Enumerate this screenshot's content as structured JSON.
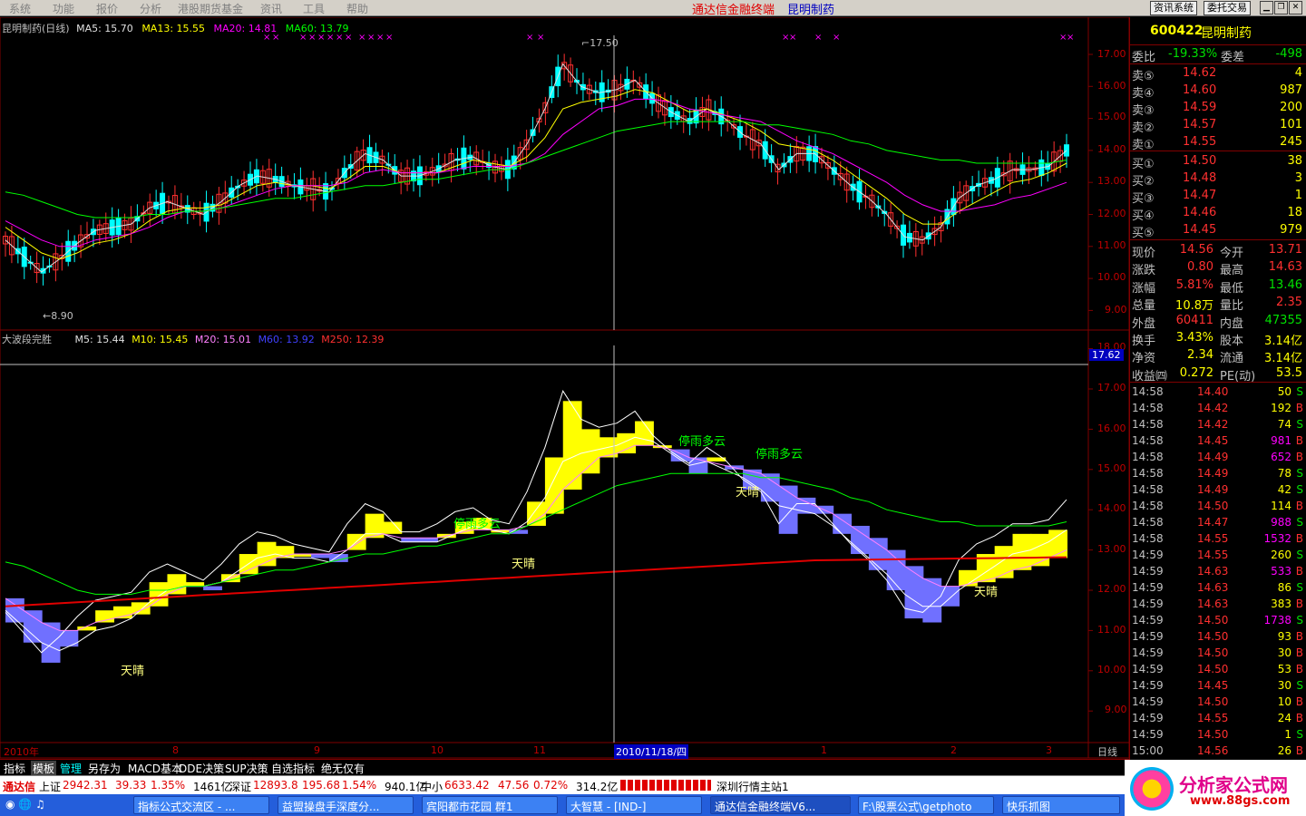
{
  "menubar": {
    "items": [
      "系统",
      "功能",
      "报价",
      "分析",
      "港股期货基金",
      "资讯",
      "工具",
      "帮助"
    ],
    "app_title": "通达信金融终端",
    "stock_title": "昆明制药",
    "btn_info": "资讯系统",
    "btn_trade": "委托交易"
  },
  "top_chart": {
    "header": {
      "name": "昆明制药(日线)",
      "ma5": "MA5: 15.70",
      "ma13": "MA13: 15.55",
      "ma20": "MA20: 14.81",
      "ma60": "MA60: 13.79"
    },
    "y_ticks": [
      "17.00",
      "16.00",
      "15.00",
      "14.00",
      "13.00",
      "12.00",
      "11.00",
      "10.00",
      "9.00"
    ],
    "high_label": "17.50",
    "low_label": "8.90",
    "marker": "×"
  },
  "bottom_chart": {
    "header": {
      "name": "大波段完胜",
      "m5": "M5: 15.44",
      "m10": "M10: 15.45",
      "m20": "M20: 15.01",
      "m60": "M60: 13.92",
      "m250": "M250: 12.39"
    },
    "y_ticks": [
      "18.00",
      "17.00",
      "16.00",
      "15.00",
      "14.00",
      "13.00",
      "12.00",
      "11.00",
      "10.00",
      "9.00"
    ],
    "cursor_value": "17.62",
    "annotations": [
      {
        "text": "停雨多云",
        "color": "#00ff00"
      },
      {
        "text": "停雨多云",
        "color": "#00ff00"
      },
      {
        "text": "停雨多云",
        "color": "#00ff00"
      },
      {
        "text": "天晴",
        "color": "#ffff80"
      },
      {
        "text": "天晴",
        "color": "#ffff80"
      },
      {
        "text": "天晴",
        "color": "#ffff80"
      },
      {
        "text": "天晴",
        "color": "#ffff80"
      }
    ]
  },
  "x_axis": {
    "labels": [
      "2010年",
      "8",
      "9",
      "10",
      "11",
      "2010/11/18/四",
      "1",
      "2",
      "3"
    ],
    "period": "日线"
  },
  "chart_data": {
    "type": "line",
    "title": "",
    "ylim": [
      8.5,
      17.6
    ],
    "series": [
      {
        "name": "MA5",
        "values": [
          11.2,
          10.7,
          10.2,
          10.6,
          11.1,
          11.5,
          11.6,
          11.7,
          12.2,
          12.4,
          12.2,
          12.0,
          12.4,
          12.9,
          13.2,
          13.1,
          12.9,
          12.8,
          12.7,
          13.4,
          13.9,
          13.7,
          13.2,
          13.2,
          13.4,
          13.7,
          13.8,
          13.5,
          13.4,
          14.2,
          15.3,
          16.7,
          16.0,
          15.8,
          15.9,
          16.2,
          15.6,
          15.2,
          14.9,
          15.3,
          15.0,
          14.5,
          14.2,
          13.4,
          13.9,
          13.9,
          13.4,
          12.9,
          12.5,
          12.0,
          11.3,
          11.2,
          11.6,
          12.5,
          12.9,
          13.1,
          13.4,
          13.4,
          13.5,
          14.0
        ]
      },
      {
        "name": "MA13",
        "values": [
          11.6,
          11.2,
          10.8,
          10.6,
          10.8,
          11.1,
          11.2,
          11.4,
          11.8,
          12.1,
          12.2,
          12.2,
          12.3,
          12.6,
          12.9,
          13.0,
          12.9,
          12.9,
          12.8,
          13.1,
          13.5,
          13.5,
          13.3,
          13.3,
          13.3,
          13.5,
          13.7,
          13.6,
          13.5,
          13.8,
          14.4,
          15.3,
          15.5,
          15.6,
          15.7,
          15.9,
          15.8,
          15.5,
          15.2,
          15.3,
          15.1,
          14.9,
          14.6,
          14.2,
          14.1,
          14.0,
          13.7,
          13.3,
          12.9,
          12.5,
          12.0,
          11.7,
          11.7,
          12.1,
          12.4,
          12.7,
          13.0,
          13.1,
          13.3,
          13.6
        ]
      },
      {
        "name": "MA20",
        "values": [
          11.8,
          11.5,
          11.2,
          11.0,
          11.0,
          11.2,
          11.3,
          11.4,
          11.6,
          11.9,
          12.1,
          12.1,
          12.2,
          12.4,
          12.6,
          12.8,
          12.9,
          12.9,
          12.9,
          13.0,
          13.3,
          13.4,
          13.3,
          13.3,
          13.3,
          13.4,
          13.5,
          13.5,
          13.5,
          13.6,
          13.9,
          14.5,
          14.9,
          15.3,
          15.4,
          15.6,
          15.6,
          15.5,
          15.3,
          15.2,
          15.1,
          15.0,
          14.9,
          14.6,
          14.3,
          14.1,
          13.9,
          13.6,
          13.3,
          13.0,
          12.6,
          12.3,
          12.1,
          12.1,
          12.2,
          12.3,
          12.5,
          12.6,
          12.8,
          13.0
        ]
      },
      {
        "name": "MA60",
        "values": [
          12.7,
          12.6,
          12.4,
          12.2,
          12.0,
          11.9,
          11.9,
          11.9,
          12.0,
          12.0,
          12.1,
          12.1,
          12.2,
          12.3,
          12.4,
          12.5,
          12.5,
          12.6,
          12.7,
          12.8,
          12.9,
          12.9,
          13.0,
          13.1,
          13.1,
          13.2,
          13.3,
          13.4,
          13.4,
          13.6,
          13.8,
          14.0,
          14.2,
          14.4,
          14.6,
          14.7,
          14.8,
          14.9,
          14.9,
          14.9,
          14.9,
          14.9,
          14.8,
          14.8,
          14.7,
          14.6,
          14.5,
          14.3,
          14.2,
          14.0,
          13.9,
          13.8,
          13.7,
          13.7,
          13.6,
          13.6,
          13.6,
          13.6,
          13.6,
          13.7
        ]
      }
    ]
  },
  "right_panel": {
    "code": "600422",
    "name": "昆明制药",
    "weibi_label": "委比",
    "weibi": "-19.33%",
    "weicha_label": "委差",
    "weicha": "-498",
    "asks": [
      {
        "label": "卖⑤",
        "price": "14.62",
        "vol": "4"
      },
      {
        "label": "卖④",
        "price": "14.60",
        "vol": "987"
      },
      {
        "label": "卖③",
        "price": "14.59",
        "vol": "200"
      },
      {
        "label": "卖②",
        "price": "14.57",
        "vol": "101"
      },
      {
        "label": "卖①",
        "price": "14.55",
        "vol": "245"
      }
    ],
    "bids": [
      {
        "label": "买①",
        "price": "14.50",
        "vol": "38"
      },
      {
        "label": "买②",
        "price": "14.48",
        "vol": "3"
      },
      {
        "label": "买③",
        "price": "14.47",
        "vol": "1"
      },
      {
        "label": "买④",
        "price": "14.46",
        "vol": "18"
      },
      {
        "label": "买⑤",
        "price": "14.45",
        "vol": "979"
      }
    ],
    "stats": [
      {
        "l1": "现价",
        "v1": "14.56",
        "c1": "#ff3030",
        "l2": "今开",
        "v2": "13.71",
        "c2": "#ff3030"
      },
      {
        "l1": "涨跌",
        "v1": "0.80",
        "c1": "#ff3030",
        "l2": "最高",
        "v2": "14.63",
        "c2": "#ff3030"
      },
      {
        "l1": "涨幅",
        "v1": "5.81%",
        "c1": "#ff3030",
        "l2": "最低",
        "v2": "13.46",
        "c2": "#00e000"
      },
      {
        "l1": "总量",
        "v1": "10.8万",
        "c1": "#ffff00",
        "l2": "量比",
        "v2": "2.35",
        "c2": "#ff3030"
      },
      {
        "l1": "外盘",
        "v1": "60411",
        "c1": "#ff3030",
        "l2": "内盘",
        "v2": "47355",
        "c2": "#00e000"
      },
      {
        "l1": "换手",
        "v1": "3.43%",
        "c1": "#ffff00",
        "l2": "股本",
        "v2": "3.14亿",
        "c2": "#ffff00"
      },
      {
        "l1": "净资",
        "v1": "2.34",
        "c1": "#ffff00",
        "l2": "流通",
        "v2": "3.14亿",
        "c2": "#ffff00"
      },
      {
        "l1": "收益㈣",
        "v1": "0.272",
        "c1": "#ffff00",
        "l2": "PE(动)",
        "v2": "53.5",
        "c2": "#ffff00"
      }
    ],
    "ticks": [
      {
        "t": "14:58",
        "p": "14.40",
        "v": "50",
        "s": "S"
      },
      {
        "t": "14:58",
        "p": "14.42",
        "v": "192",
        "s": "B"
      },
      {
        "t": "14:58",
        "p": "14.42",
        "v": "74",
        "s": "S"
      },
      {
        "t": "14:58",
        "p": "14.45",
        "v": "981",
        "s": "B"
      },
      {
        "t": "14:58",
        "p": "14.49",
        "v": "652",
        "s": "B"
      },
      {
        "t": "14:58",
        "p": "14.49",
        "v": "78",
        "s": "S"
      },
      {
        "t": "14:58",
        "p": "14.49",
        "v": "42",
        "s": "S"
      },
      {
        "t": "14:58",
        "p": "14.50",
        "v": "114",
        "s": "B"
      },
      {
        "t": "14:58",
        "p": "14.47",
        "v": "988",
        "s": "S"
      },
      {
        "t": "14:58",
        "p": "14.55",
        "v": "1532",
        "s": "B"
      },
      {
        "t": "14:59",
        "p": "14.55",
        "v": "260",
        "s": "S"
      },
      {
        "t": "14:59",
        "p": "14.63",
        "v": "533",
        "s": "B"
      },
      {
        "t": "14:59",
        "p": "14.63",
        "v": "86",
        "s": "S"
      },
      {
        "t": "14:59",
        "p": "14.63",
        "v": "383",
        "s": "B"
      },
      {
        "t": "14:59",
        "p": "14.50",
        "v": "1738",
        "s": "S"
      },
      {
        "t": "14:59",
        "p": "14.50",
        "v": "93",
        "s": "B"
      },
      {
        "t": "14:59",
        "p": "14.50",
        "v": "30",
        "s": "B"
      },
      {
        "t": "14:59",
        "p": "14.50",
        "v": "53",
        "s": "B"
      },
      {
        "t": "14:59",
        "p": "14.45",
        "v": "30",
        "s": "S"
      },
      {
        "t": "14:59",
        "p": "14.50",
        "v": "10",
        "s": "B"
      },
      {
        "t": "14:59",
        "p": "14.55",
        "v": "24",
        "s": "B"
      },
      {
        "t": "14:59",
        "p": "14.50",
        "v": "1",
        "s": "S"
      },
      {
        "t": "15:00",
        "p": "14.56",
        "v": "26",
        "s": "B"
      }
    ]
  },
  "tabs": [
    "指标",
    "模板",
    "管理",
    "另存为",
    "MACD基本",
    "DDE决策",
    "SUP决策",
    "自选指标",
    "绝无仅有"
  ],
  "statusbar": {
    "brand": "通达信",
    "sh_label": "上证",
    "sh_val": "2942.31",
    "sh_chg": "39.33",
    "sh_pct": "1.35%",
    "sh_amt": "1461亿",
    "sz_label": "深证",
    "sz_val": "12893.8",
    "sz_chg": "195.68",
    "sz_pct": "1.54%",
    "sz_amt": "940.1亿",
    "zx_label": "中小",
    "zx_val": "6633.42",
    "zx_chg": "47.56",
    "zx_pct": "0.72%",
    "zx_amt": "314.2亿",
    "server": "深圳行情主站1"
  },
  "taskbar": {
    "items": [
      "指标公式交流区 - ...",
      "益盟操盘手深度分...",
      "宾阳都市花园 群1",
      "大智慧 - [IND-]",
      "通达信金融终端V6...",
      "F:\\股票公式\\getphoto",
      "快乐抓图"
    ]
  },
  "logo": {
    "text": "分析家公式网",
    "url": "www.88gs.com"
  },
  "colors": {
    "up": "#ff3030",
    "down": "#00ffff",
    "accent": "#ffff00",
    "blue_band": "#7070ff",
    "red_line": "#e00000"
  }
}
